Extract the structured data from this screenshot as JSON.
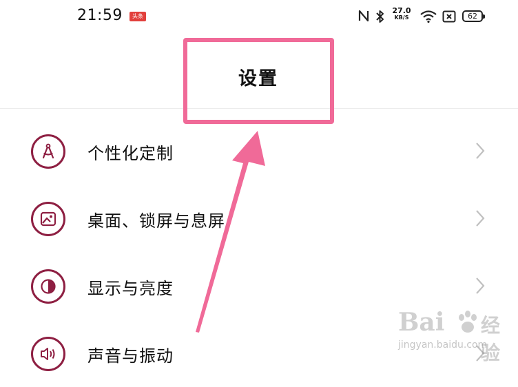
{
  "status_bar": {
    "time": "21:59",
    "news_badge": "头条",
    "net_speed_value": "27.0",
    "net_speed_unit": "KB/S",
    "battery_level": "62",
    "icons": [
      "nfc-icon",
      "bluetooth-icon",
      "wifi-icon",
      "sim-off-icon",
      "battery-icon"
    ]
  },
  "header": {
    "title": "设置"
  },
  "settings": {
    "items": [
      {
        "label": "个性化定制",
        "icon": "compass-icon"
      },
      {
        "label": "桌面、锁屏与息屏",
        "icon": "wallpaper-icon"
      },
      {
        "label": "显示与亮度",
        "icon": "contrast-icon"
      },
      {
        "label": "声音与振动",
        "icon": "speaker-icon"
      }
    ]
  },
  "annotation": {
    "color": "#f06a98"
  },
  "watermark": {
    "brand": "Bai",
    "brand_suffix": "经验",
    "url": "jingyan.baidu.com"
  },
  "colors": {
    "icon_accent": "#8e1f42",
    "chevron": "#c0c0c0",
    "badge": "#e2403c"
  }
}
